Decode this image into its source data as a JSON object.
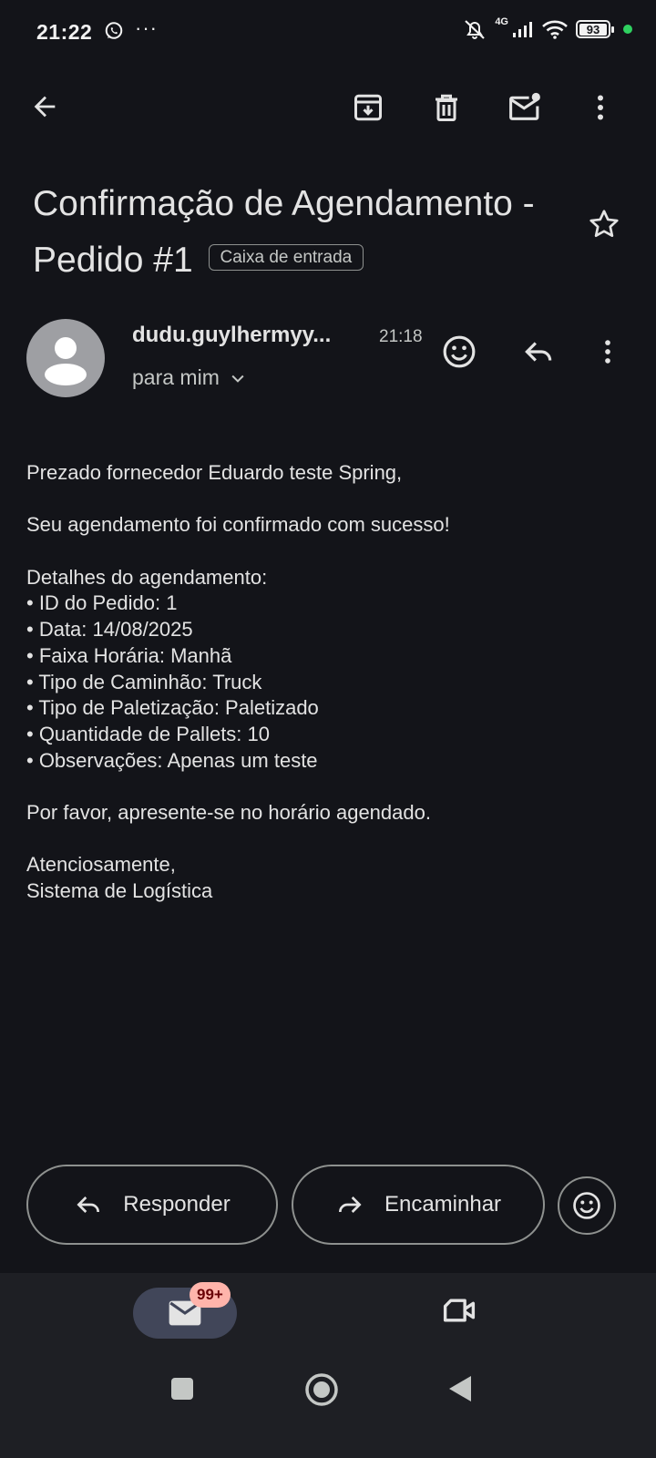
{
  "status_bar": {
    "time": "21:22",
    "more": "···",
    "network": "4G",
    "battery": "93"
  },
  "toolbar": {
    "icons": [
      "back-arrow-icon",
      "archive-icon",
      "delete-icon",
      "mark-unread-icon",
      "more-vert-icon"
    ]
  },
  "email": {
    "subject": "Confirmação de Agendamento - Pedido #1",
    "label": "Caixa de entrada",
    "sender": "dudu.guylhermyy...",
    "time": "21:18",
    "recipient": "para mim",
    "body": {
      "greeting": "Prezado fornecedor Eduardo teste Spring,",
      "confirmation": "Seu agendamento foi confirmado com sucesso!",
      "details_header": "Detalhes do agendamento:",
      "details": [
        "• ID do Pedido: 1",
        "• Data: 14/08/2025",
        "• Faixa Horária: Manhã",
        "• Tipo de Caminhão: Truck",
        "• Tipo de Paletização: Paletizado",
        "• Quantidade de Pallets: 10",
        "• Observações: Apenas um teste"
      ],
      "request": "Por favor, apresente-se no horário agendado.",
      "closing": "Atenciosamente,",
      "signature": "Sistema de Logística"
    }
  },
  "actions": {
    "reply": "Responder",
    "forward": "Encaminhar"
  },
  "bottom_nav": {
    "mail_badge": "99+"
  },
  "colors": {
    "background": "#131419",
    "text": "#e3e3e3",
    "badge_bg": "#ffb4ab",
    "selected_pill": "#414659"
  }
}
